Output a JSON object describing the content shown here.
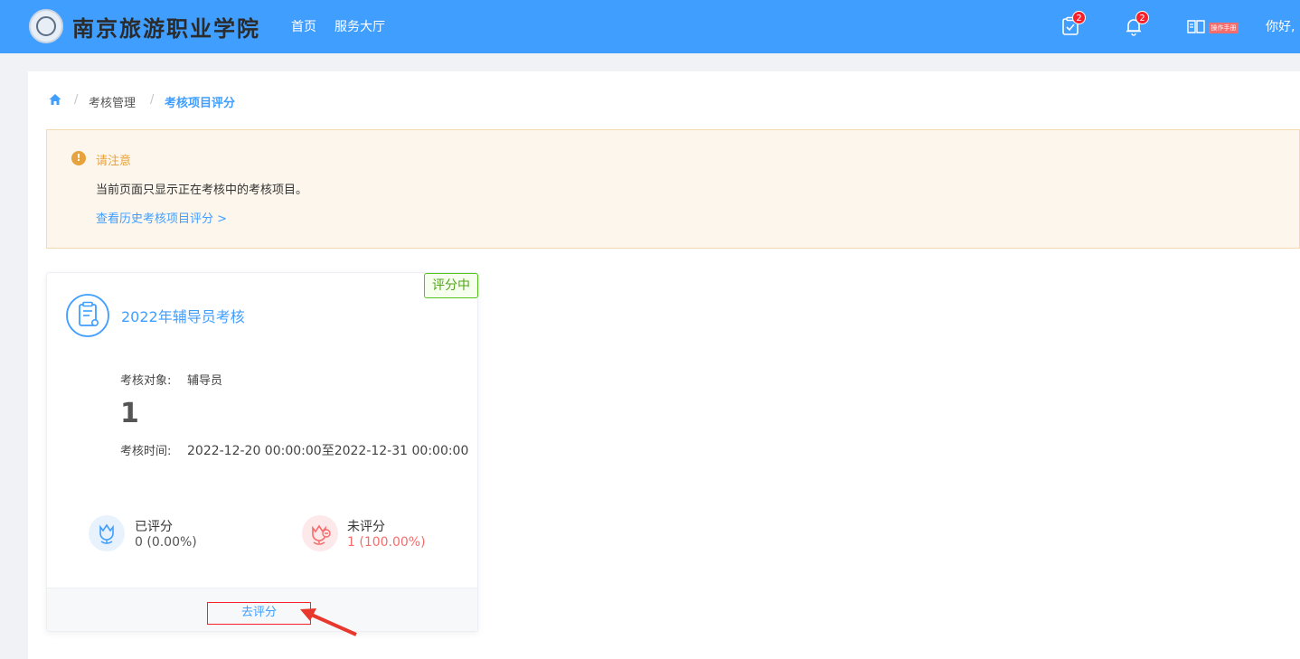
{
  "header": {
    "school_name": "南京旅游职业学院",
    "nav": {
      "home": "首页",
      "service_hall": "服务大厅"
    },
    "todo_badge": "2",
    "notify_badge": "2",
    "manual_tag": "操作手册",
    "greeting": "你好,",
    "colors": {
      "bar": "#409eff"
    }
  },
  "breadcrumb": {
    "items": [
      "考核管理",
      "考核项目评分"
    ],
    "separator": "/"
  },
  "notice": {
    "title": "请注意",
    "text": "当前页面只显示正在考核中的考核项目。",
    "link": "查看历史考核项目评分 >"
  },
  "card": {
    "status": "评分中",
    "title": "2022年辅导员考核",
    "target_label": "考核对象:",
    "target_value": "辅导员",
    "count": "1",
    "time_label": "考核时间:",
    "time_value": "2022-12-20 00:00:00至2022-12-31 00:00:00",
    "rated": {
      "label": "已评分",
      "value": "0 (0.00%)"
    },
    "unrated": {
      "label": "未评分",
      "value": "1 (100.00%)"
    },
    "action": "去评分"
  },
  "icons": {
    "logo": "school-emblem-icon",
    "todo": "clipboard-check-icon",
    "notify": "bell-icon",
    "manual": "book-help-icon",
    "home": "home-icon",
    "warning": "warning-icon",
    "card": "document-award-icon",
    "rated": "flower-icon",
    "unrated": "flower-minus-icon",
    "pointer": "red-arrow-icon"
  }
}
